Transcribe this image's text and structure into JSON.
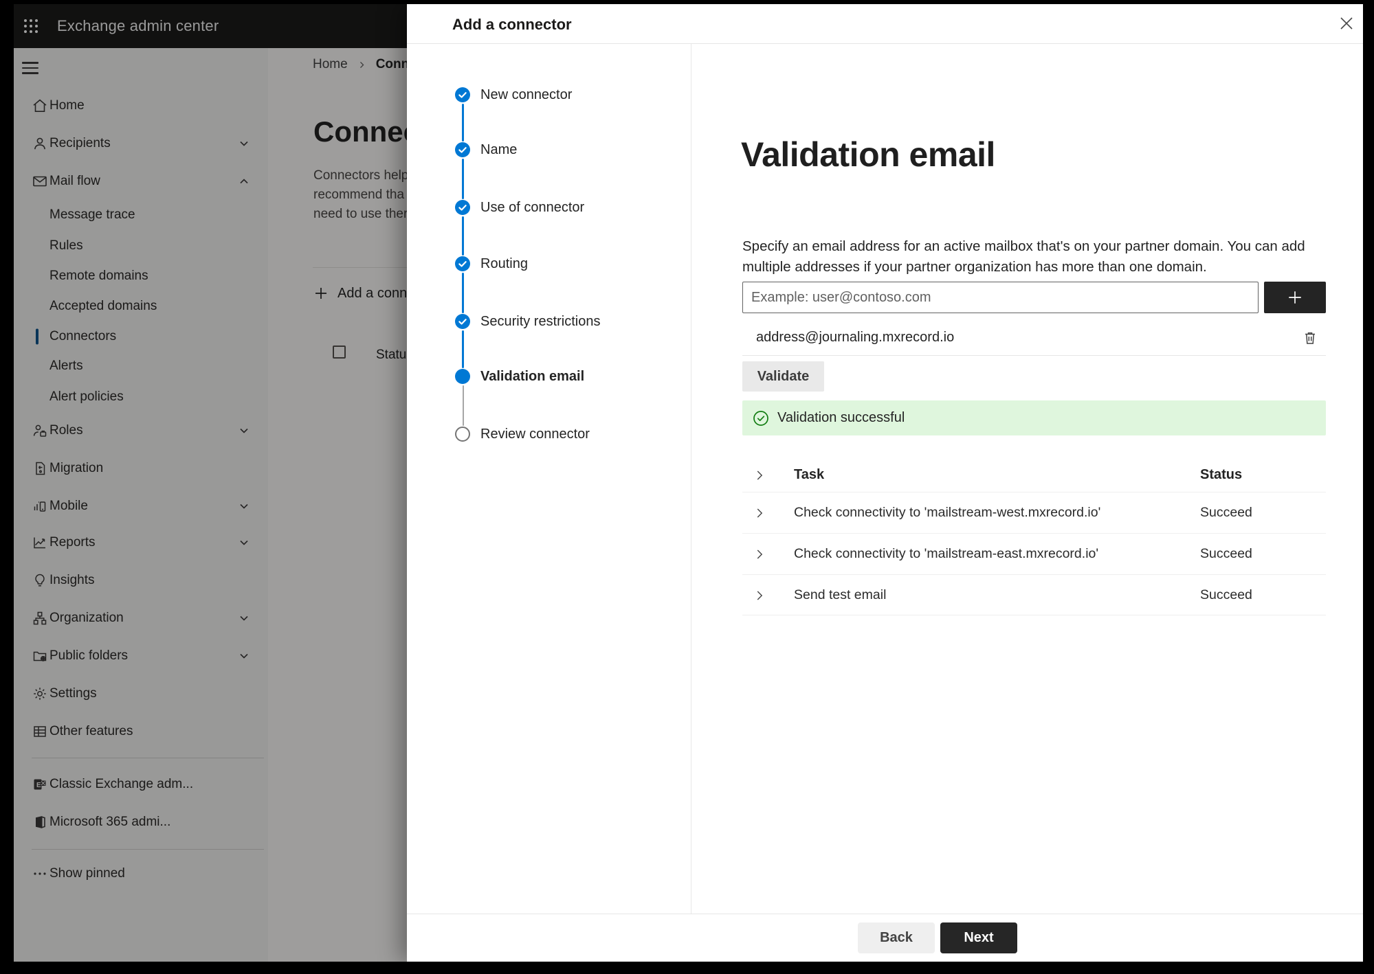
{
  "colors": {
    "accent": "#0078d4",
    "success": "#107c10",
    "success_bg": "#dff6dd",
    "header_bg": "#1c1b1a"
  },
  "chrome": {
    "app_title": "Exchange admin center"
  },
  "sidebar": {
    "items": [
      {
        "icon": "home-icon",
        "label": "Home"
      },
      {
        "icon": "recipients-icon",
        "label": "Recipients",
        "chevron": "down"
      },
      {
        "icon": "mail-flow-icon",
        "label": "Mail flow",
        "chevron": "up"
      },
      {
        "label": "Message trace"
      },
      {
        "label": "Rules"
      },
      {
        "label": "Remote domains"
      },
      {
        "label": "Accepted domains"
      },
      {
        "label": "Connectors",
        "selected": true
      },
      {
        "label": "Alerts"
      },
      {
        "label": "Alert policies"
      },
      {
        "icon": "roles-icon",
        "label": "Roles",
        "chevron": "down"
      },
      {
        "icon": "migration-icon",
        "label": "Migration"
      },
      {
        "icon": "mobile-icon",
        "label": "Mobile",
        "chevron": "down"
      },
      {
        "icon": "reports-icon",
        "label": "Reports",
        "chevron": "down"
      },
      {
        "icon": "insights-icon",
        "label": "Insights"
      },
      {
        "icon": "organization-icon",
        "label": "Organization",
        "chevron": "down"
      },
      {
        "icon": "public-folders-icon",
        "label": "Public folders",
        "chevron": "down"
      },
      {
        "icon": "settings-icon",
        "label": "Settings"
      },
      {
        "icon": "other-features-icon",
        "label": "Other features"
      },
      {
        "icon": "classic-exchange-icon",
        "label": "Classic Exchange adm..."
      },
      {
        "icon": "m365-icon",
        "label": "Microsoft 365 admi..."
      },
      {
        "icon": "more-icon",
        "label": "Show pinned"
      }
    ]
  },
  "background": {
    "breadcrumb": {
      "home": "Home",
      "current": "Conne"
    },
    "page_title": "Connect",
    "para_lines": [
      "Connectors help",
      "recommend tha",
      "need to use ther"
    ],
    "add_button": "Add a conn",
    "status_header": "Status"
  },
  "dialog": {
    "title": "Add a connector",
    "steps": [
      {
        "label": "New connector",
        "state": "done"
      },
      {
        "label": "Name",
        "state": "done"
      },
      {
        "label": "Use of connector",
        "state": "done"
      },
      {
        "label": "Routing",
        "state": "done"
      },
      {
        "label": "Security restrictions",
        "state": "done"
      },
      {
        "label": "Validation email",
        "state": "current"
      },
      {
        "label": "Review connector",
        "state": "todo"
      }
    ],
    "content": {
      "heading": "Validation email",
      "description_lines": [
        "Specify an email address for an active mailbox that's on your partner domain. You can add",
        "multiple addresses if your partner organization has more than one domain."
      ],
      "input_placeholder": "Example: user@contoso.com",
      "address": "address@journaling.mxrecord.io",
      "validate_label": "Validate",
      "banner_text": "Validation successful",
      "table": {
        "col_task": "Task",
        "col_status": "Status",
        "rows": [
          {
            "task": "Check connectivity to 'mailstream-west.mxrecord.io'",
            "status": "Succeed"
          },
          {
            "task": "Check connectivity to 'mailstream-east.mxrecord.io'",
            "status": "Succeed"
          },
          {
            "task": "Send test email",
            "status": "Succeed"
          }
        ]
      }
    },
    "footer": {
      "back": "Back",
      "next": "Next"
    }
  }
}
